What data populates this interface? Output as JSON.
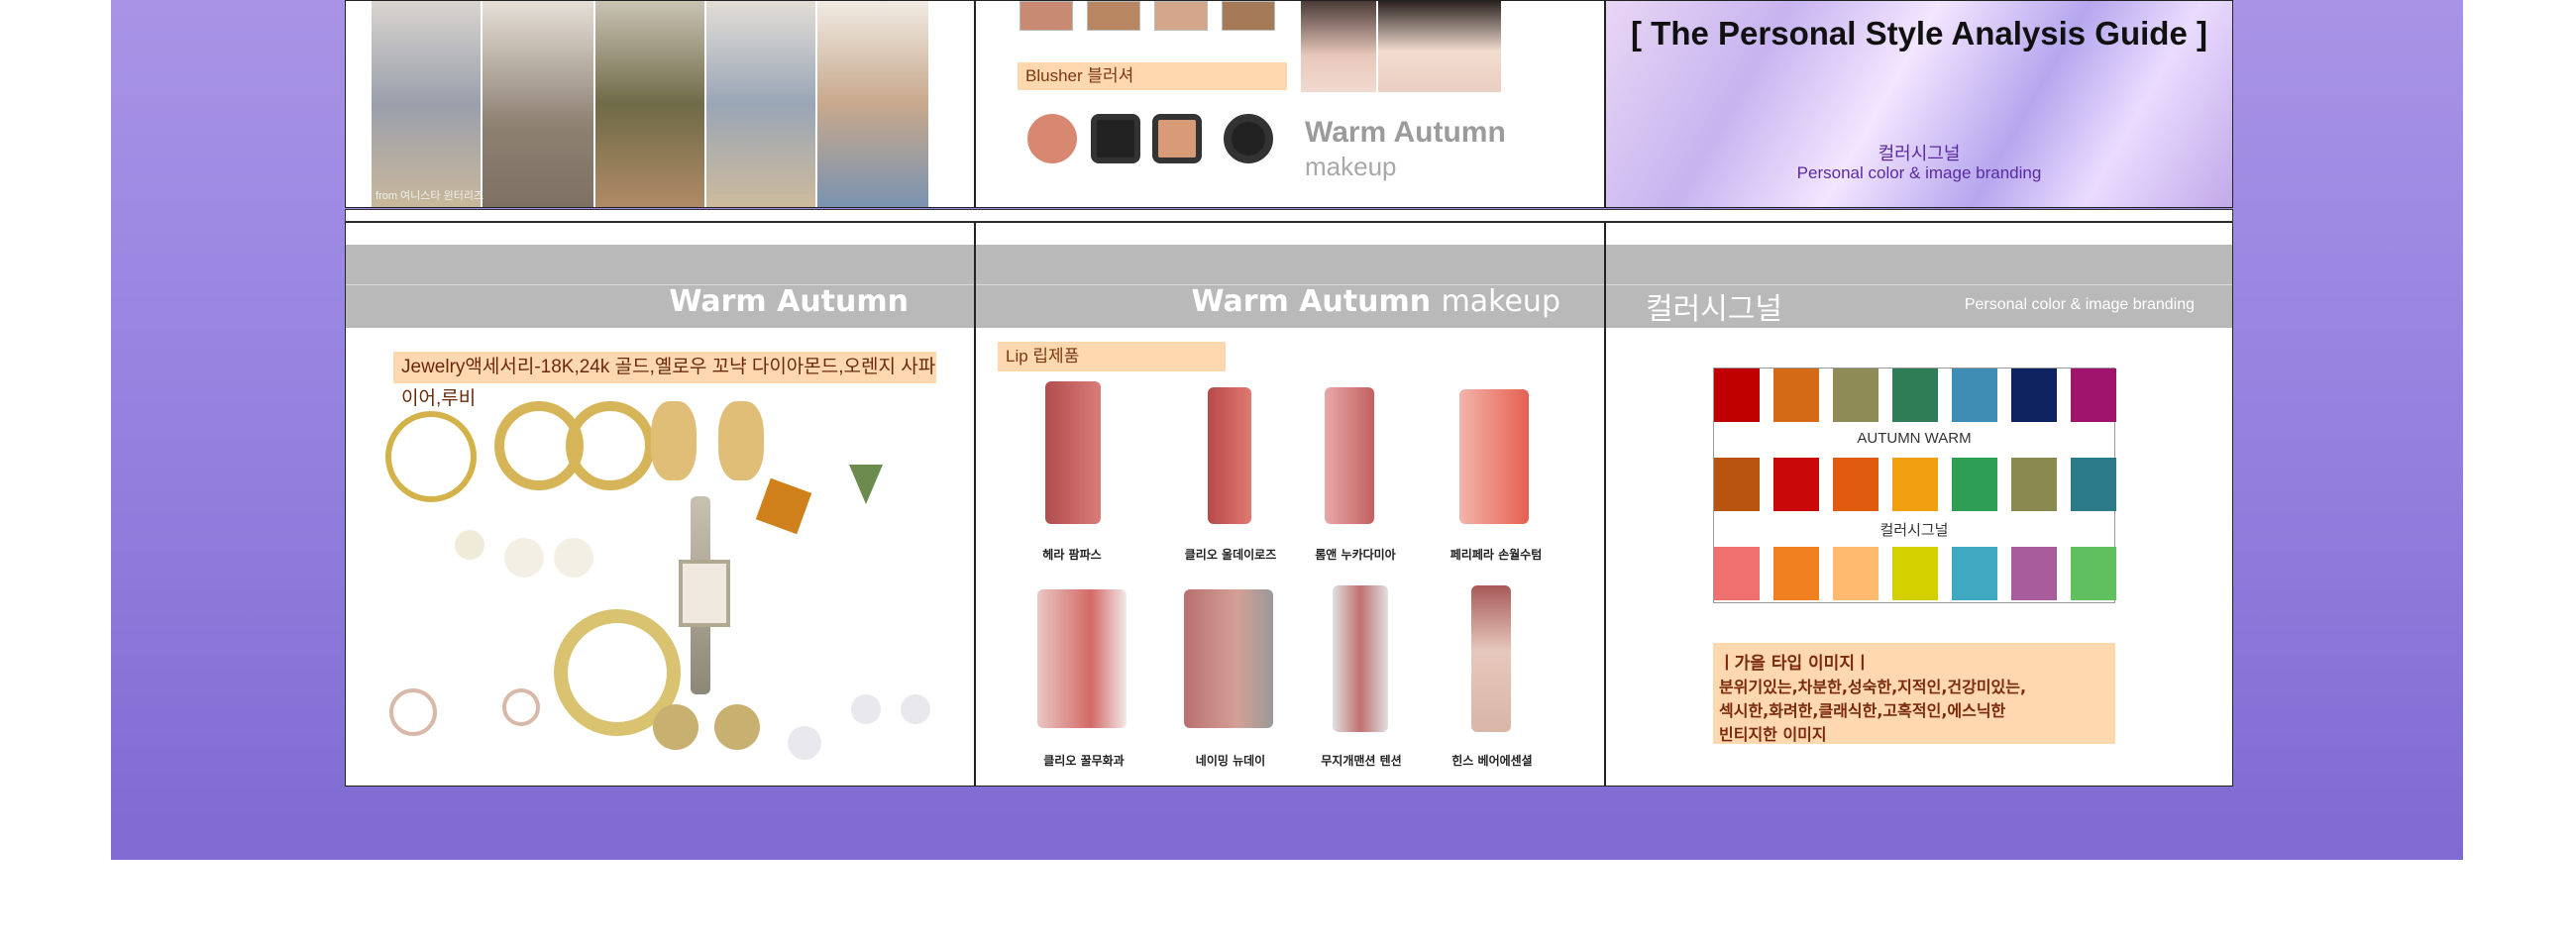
{
  "top_left": {
    "credit": "from 여니스타 윈터리즈"
  },
  "top_mid": {
    "blusher_label": "Blusher 블러셔",
    "title": "Warm Autumn",
    "subtitle": "makeup"
  },
  "top_right": {
    "guide_title": "[ The Personal Style Analysis Guide ]",
    "brand_ko": "컬러시그널",
    "brand_en": "Personal color & image branding"
  },
  "bottom_left": {
    "title": "Warm Autumn",
    "jewelry_label": "Jewelry액세서리-18K,24k 골드,옐로우 꼬냑 다이아몬드,오렌지 사파이어,루비"
  },
  "bottom_mid": {
    "title_bold": "Warm Autumn",
    "title_light": "makeup",
    "lip_label": "Lip 립제품",
    "lip_names": [
      "헤라 팜파스",
      "클리오 울데이로즈",
      "롬앤 누카다미아",
      "페리페라 손월수텀",
      "클리오 꿀무화과",
      "네이밍 뉴데이",
      "무지개맨션 텐션",
      "힌스 베어에센셜"
    ]
  },
  "bottom_right": {
    "brand_ko": "컬러시그널",
    "brand_en": "Personal color & image branding",
    "row1_label": "AUTUMN WARM",
    "row2_label": "컬러시그널",
    "row1": [
      "#c00000",
      "#d56a16",
      "#8f8b57",
      "#2e7d57",
      "#3d8db5",
      "#0f2260",
      "#a0146e"
    ],
    "row2": [
      "#b85410",
      "#c90808",
      "#e05a10",
      "#f0a010",
      "#2e9e55",
      "#8a8a50",
      "#2a7a8a"
    ],
    "row3": [
      "#f07070",
      "#f08020",
      "#ffba70",
      "#d4d000",
      "#40a8c0",
      "#a85c9c",
      "#60c060"
    ],
    "image_title": "ㅣ가을 타입 이미지ㅣ",
    "image_lines": [
      "분위기있는,차분한,성숙한,지적인,건강미있는,",
      "섹시한,화려한,클래식한,고혹적인,에스닉한",
      "빈티지한 이미지"
    ]
  }
}
